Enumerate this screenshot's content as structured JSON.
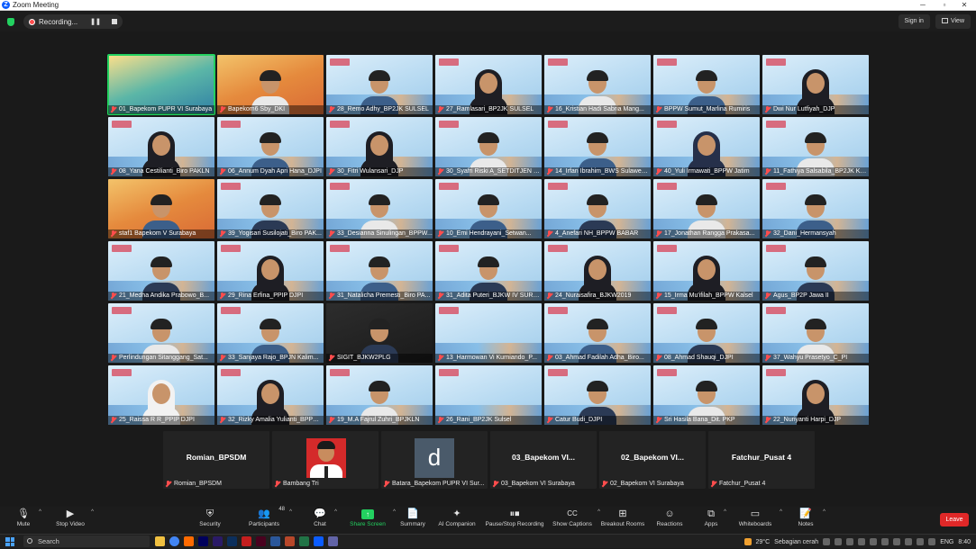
{
  "window": {
    "title": "Zoom Meeting",
    "signin": "Sign in",
    "view": "View"
  },
  "recording": {
    "label": "Recording..."
  },
  "participants": [
    {
      "name": "01_Bapekom PUPR VI Surabaya",
      "style": "stage",
      "kind": "none",
      "active": true
    },
    {
      "name": "Bapekom6 Sby_DKI",
      "style": "scene",
      "kind": "man-dark"
    },
    {
      "name": "28_Remo Adhy_BP2JK SULSEL",
      "style": "blue",
      "kind": "man-dark"
    },
    {
      "name": "27_Ramlasari_BP2JK SULSEL",
      "style": "blue",
      "kind": "hijab-black"
    },
    {
      "name": "16_Kristian Hadi Sabria Mang...",
      "style": "blue",
      "kind": "man-dark"
    },
    {
      "name": "BPPW Sumut_Marlina Rumiris",
      "style": "blue",
      "kind": "woman-short"
    },
    {
      "name": "Dwi Nur Lutfiyah_DJP",
      "style": "blue",
      "kind": "hijab-black"
    },
    {
      "name": "08_Yana Cestilianti_Biro PAKLN",
      "style": "blue",
      "kind": "hijab-black"
    },
    {
      "name": "06_Annum Dyah Apri Hana_DJPI",
      "style": "blue",
      "kind": "woman-short"
    },
    {
      "name": "30_Fitri Wulansari_DJP",
      "style": "blue",
      "kind": "hijab-black"
    },
    {
      "name": "30_Syafri Riski A_SETDITJEN S...",
      "style": "blue",
      "kind": "man-dark"
    },
    {
      "name": "14_Irfan Ibrahim_BWS Sulawesi...",
      "style": "blue",
      "kind": "man-dark"
    },
    {
      "name": "40_Yuli Irmawati_BPPW Jatim",
      "style": "blue",
      "kind": "hijab-navy"
    },
    {
      "name": "11_Fathiya Salsabila_BP2JK KAL...",
      "style": "blue",
      "kind": "woman-short"
    },
    {
      "name": "staf1 Bapekom V Surabaya",
      "style": "scene",
      "kind": "man-dark"
    },
    {
      "name": "39_Yogisari Susilojati_Biro PAK...",
      "style": "blue",
      "kind": "woman-short"
    },
    {
      "name": "33_Desianna Sinulingan_BPPW...",
      "style": "blue",
      "kind": "woman-short"
    },
    {
      "name": "10_Emi Hendrayani_Setwan...",
      "style": "blue",
      "kind": "man-dark"
    },
    {
      "name": "4_Anefari NH_BPPW BABAR",
      "style": "blue",
      "kind": "man-dark"
    },
    {
      "name": "17_Jonathan Rangga Prakasa...",
      "style": "blue",
      "kind": "man-dark"
    },
    {
      "name": "32_Dani_Hermansyah",
      "style": "blue",
      "kind": "man-dark"
    },
    {
      "name": "21_Medha Andika Prabowo_B...",
      "style": "blue",
      "kind": "man-dark"
    },
    {
      "name": "29_Rina Erfina_PPIP DJPI",
      "style": "blue",
      "kind": "hijab-black"
    },
    {
      "name": "31_Natalicha Premesti_Biro PA...",
      "style": "blue",
      "kind": "woman-short"
    },
    {
      "name": "31_Adita Puteri_BJKW IV SURA...",
      "style": "blue",
      "kind": "woman-short"
    },
    {
      "name": "24_Nuraisafira_BJKW2019",
      "style": "blue",
      "kind": "hijab-black"
    },
    {
      "name": "15_Irma Mu'ifilah_BPPW Kalsel",
      "style": "blue",
      "kind": "hijab-black"
    },
    {
      "name": "Agus_BP2P Jawa II",
      "style": "blue",
      "kind": "man-dark"
    },
    {
      "name": "Perlindungan Sitanggang_Sat...",
      "style": "blue",
      "kind": "man-dark"
    },
    {
      "name": "33_Sanjaya Rajo_BPJN Kalim...",
      "style": "blue",
      "kind": "man-dark"
    },
    {
      "name": "SIGIT_BJKW2PLG",
      "style": "dark",
      "kind": "man-dark"
    },
    {
      "name": "13_Harmowan Vi Kurniando_P...",
      "style": "blue",
      "kind": "none"
    },
    {
      "name": "03_Ahmad Fadilah Adha_Biro...",
      "style": "blue",
      "kind": "man-dark"
    },
    {
      "name": "08_Ahmad Shauqi_DJPI",
      "style": "blue",
      "kind": "man-dark"
    },
    {
      "name": "37_Wahyu Prasetyo_C_PI",
      "style": "blue",
      "kind": "man-dark"
    },
    {
      "name": "25_Raissa R R_PPIP DJPI",
      "style": "blue",
      "kind": "hijab-white"
    },
    {
      "name": "32_Rizky Amalia Yulianti_BPPW...",
      "style": "blue",
      "kind": "hijab-black"
    },
    {
      "name": "19_M.A Fajrul Zuhri_BPJKLN",
      "style": "blue",
      "kind": "man-dark"
    },
    {
      "name": "26_Rani_BP2JK Sulsel",
      "style": "blue",
      "kind": "none"
    },
    {
      "name": "Catur Budi_DJPI",
      "style": "blue",
      "kind": "man-dark"
    },
    {
      "name": "Sri Hasila Bana_Dit. PKP",
      "style": "blue",
      "kind": "man-dark"
    },
    {
      "name": "22_Nuriyanti Harpi_DJP",
      "style": "blue",
      "kind": "hijab-black"
    }
  ],
  "video_off": [
    {
      "big": "Romian_BPSDM",
      "name": "Romian_BPSDM",
      "kind": "text"
    },
    {
      "big": "",
      "name": "Bambang Tri",
      "kind": "photo"
    },
    {
      "big": "d",
      "name": "Batara_Bapekom PUPR VI Sur...",
      "kind": "avatar"
    },
    {
      "big": "03_Bapekom VI...",
      "name": "03_Bapekom VI Surabaya",
      "kind": "text"
    },
    {
      "big": "02_Bapekom VI...",
      "name": "02_Bapekom VI Surabaya",
      "kind": "text"
    },
    {
      "big": "Fatchur_Pusat 4",
      "name": "Fatchur_Pusat 4",
      "kind": "text"
    }
  ],
  "toolbar": {
    "mute": "Mute",
    "stop_video": "Stop Video",
    "security": "Security",
    "participants": "Participants",
    "participants_count": "48",
    "chat": "Chat",
    "share_screen": "Share Screen",
    "summary": "Summary",
    "ai_companion": "AI Companion",
    "pause_recording": "Pause/Stop Recording",
    "show_captions": "Show Captions",
    "breakout_rooms": "Breakout Rooms",
    "reactions": "Reactions",
    "apps": "Apps",
    "whiteboards": "Whiteboards",
    "notes": "Notes",
    "leave": "Leave"
  },
  "taskbar": {
    "search": "Search",
    "weather": "29°C",
    "weather_desc": "Sebagian cerah",
    "lang": "ENG",
    "time": "8:40"
  },
  "colors": {
    "share_green": "#23d160",
    "leave_red": "#e02828",
    "active_border": "#23d160"
  }
}
